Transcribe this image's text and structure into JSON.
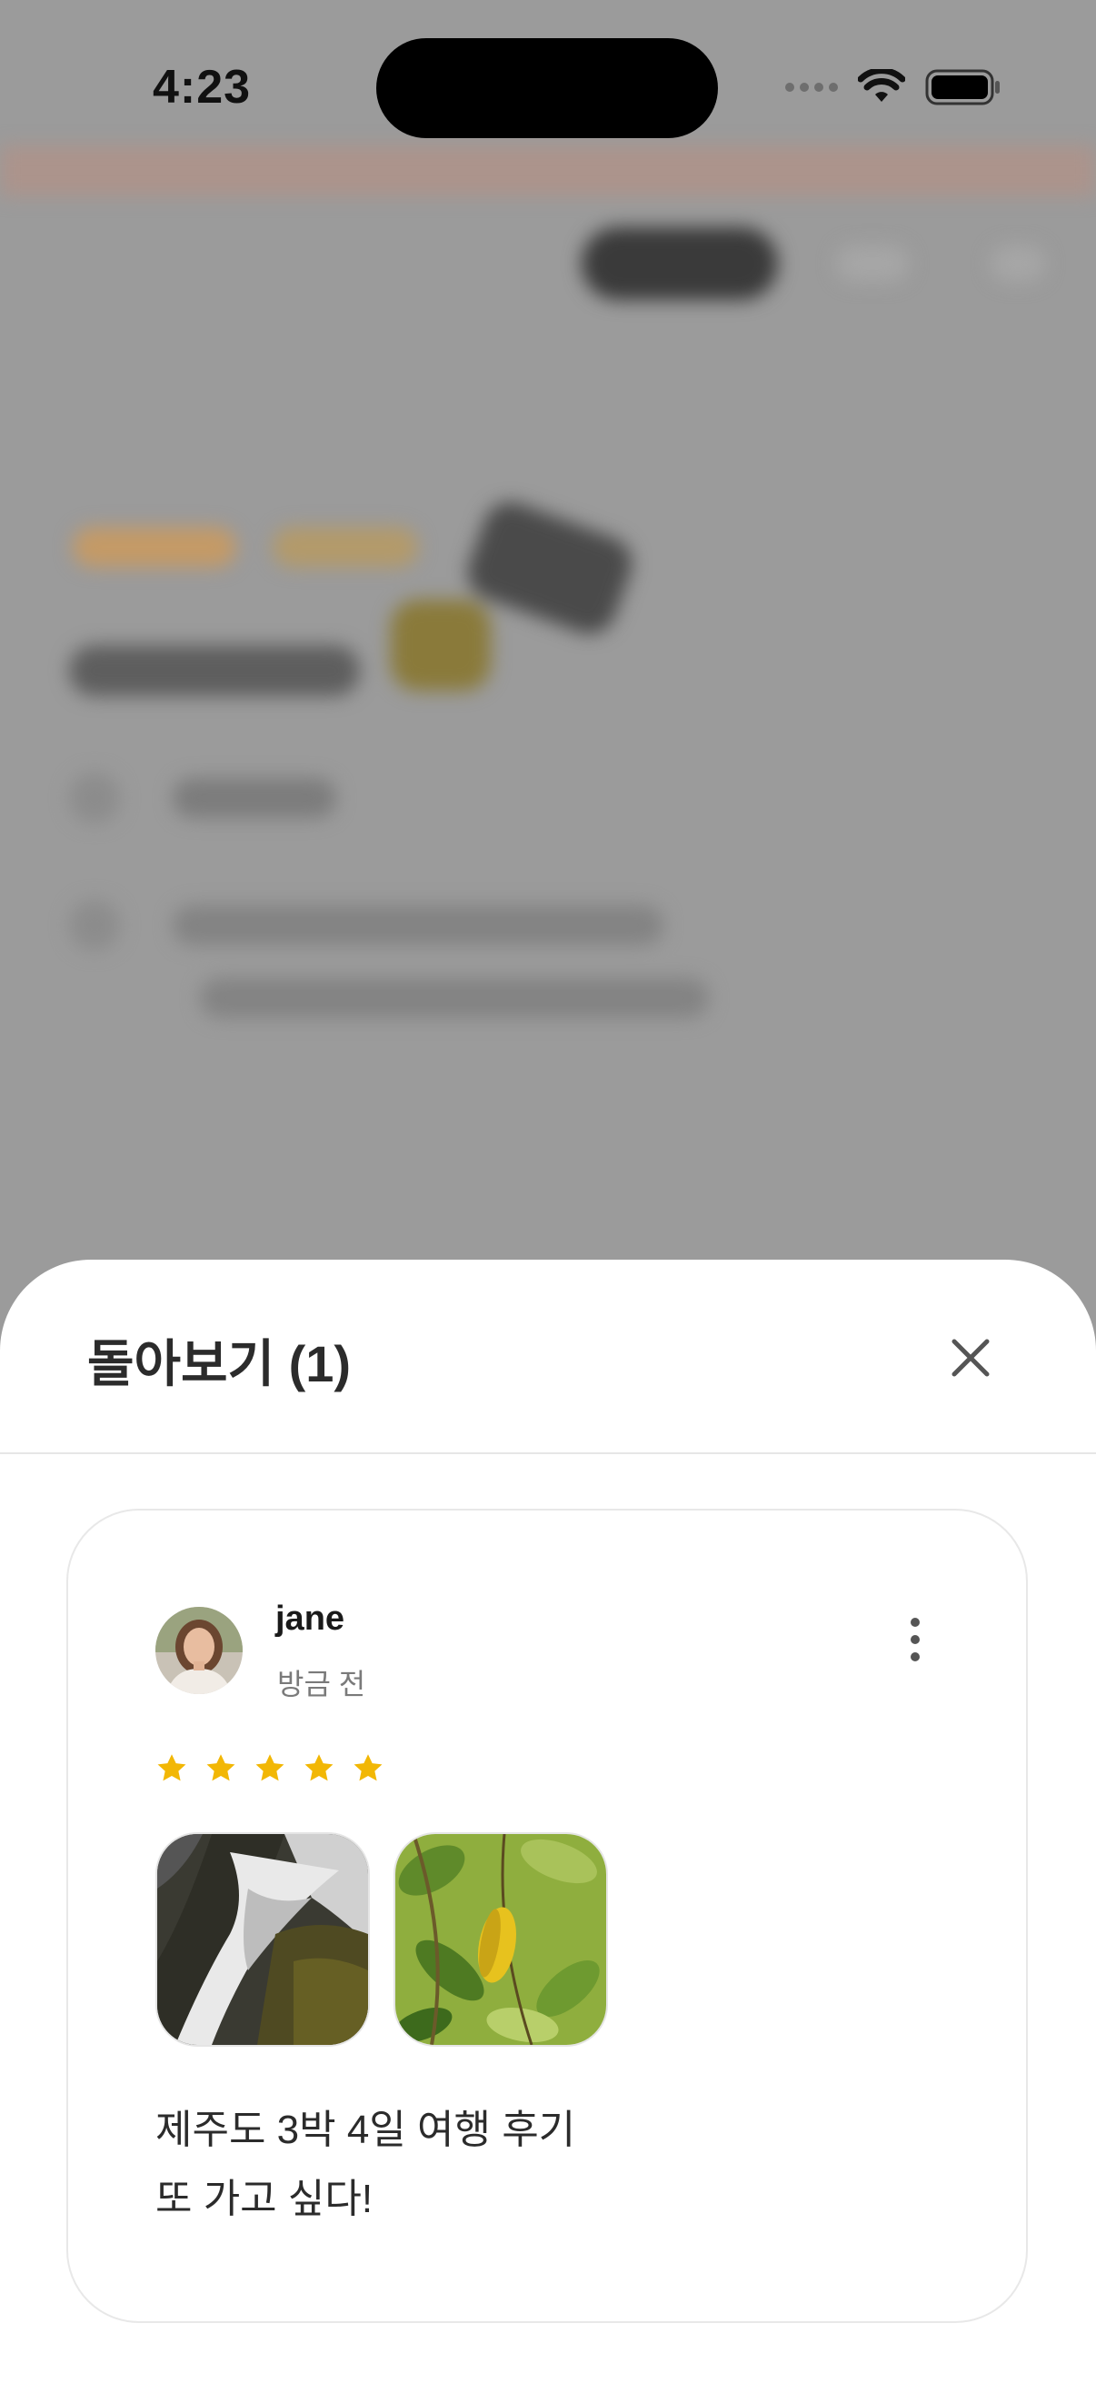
{
  "status_bar": {
    "time": "4:23",
    "icons": [
      "cellular-signal-icon",
      "wifi-icon",
      "battery-icon"
    ]
  },
  "sheet": {
    "title": "돌아보기 (1)",
    "close_icon": "close-icon"
  },
  "review": {
    "author": "jane",
    "time_ago": "방금 전",
    "rating": 5,
    "max_rating": 5,
    "photos": [
      "waterfall-photo",
      "leaves-photo"
    ],
    "text_lines": [
      "제주도 3박 4일 여행 후기",
      "또 가고 싶다!"
    ],
    "more_icon": "more-vertical-icon"
  },
  "colors": {
    "star": "#F2B705",
    "overlay": "#9b9b9b",
    "sheet_bg": "#ffffff",
    "text_primary": "#2b2b2b",
    "text_secondary": "#7a7a7a"
  }
}
